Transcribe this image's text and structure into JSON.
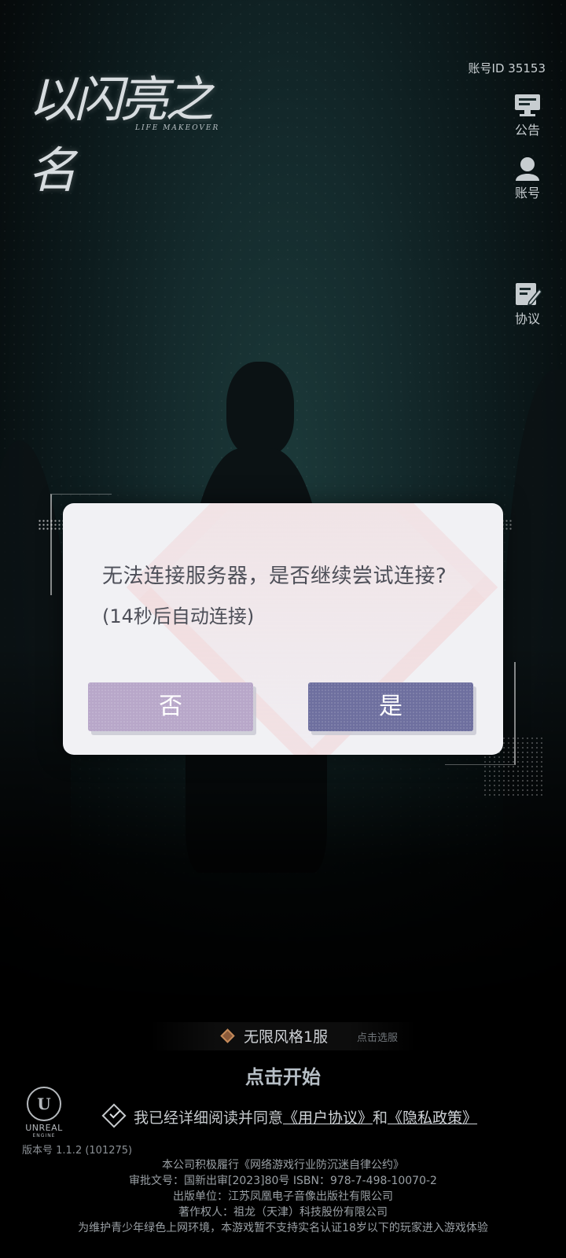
{
  "logo": {
    "title": "以闪亮之名",
    "subtitle": "LIFE MAKEOVER"
  },
  "top": {
    "account_id": "账号ID 35153"
  },
  "side_menu": {
    "announcement": "公告",
    "account": "账号",
    "agreement": "协议"
  },
  "dialog": {
    "message": "无法连接服务器，是否继续尝试连接?",
    "countdown": "(14秒后自动连接)",
    "no_label": "否",
    "yes_label": "是"
  },
  "server": {
    "name": "无限风格1服",
    "select_hint": "点击选服"
  },
  "start_label": "点击开始",
  "engine": {
    "name": "UNREAL",
    "sub": "ENGINE",
    "mark": "U"
  },
  "agreement": {
    "prefix": "我已经详细阅读并同意",
    "user_agreement": "《用户协议》",
    "and": "和",
    "privacy_policy": "《隐私政策》"
  },
  "version": "版本号  1.1.2 (101275)",
  "footer": [
    "本公司积极履行《网络游戏行业防沉迷自律公约》",
    "审批文号：国新出审[2023]80号   ISBN：978-7-498-10070-2",
    "出版单位：江苏凤凰电子音像出版社有限公司",
    "著作权人：祖龙（天津）科技股份有限公司",
    "为维护青少年绿色上网环境，本游戏暂不支持实名认证18岁以下的玩家进入游戏体验"
  ]
}
